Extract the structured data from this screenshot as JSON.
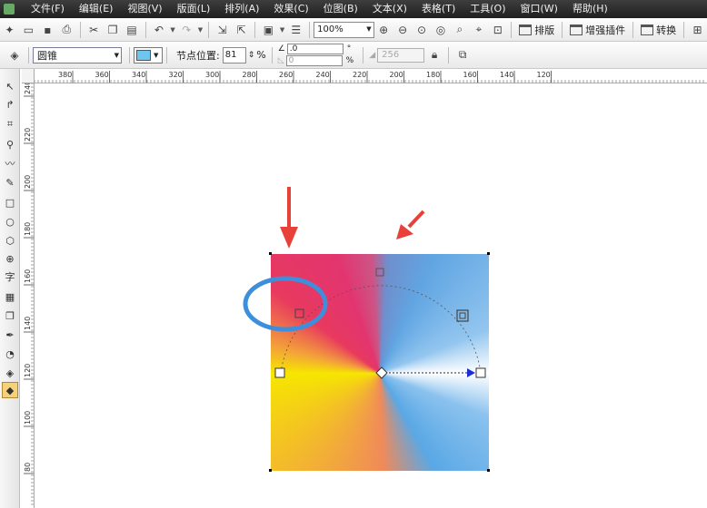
{
  "menu": [
    "文件(F)",
    "编辑(E)",
    "视图(V)",
    "版面(L)",
    "排列(A)",
    "效果(C)",
    "位图(B)",
    "文本(X)",
    "表格(T)",
    "工具(O)",
    "窗口(W)",
    "帮助(H)"
  ],
  "toolbar": {
    "zoom_value": "100%",
    "layout_label": "排版",
    "enhance_plugin_label": "增强插件",
    "convert_label": "转换"
  },
  "property_bar": {
    "fill_type": "圆锥",
    "node_position_label": "节点位置:",
    "node_position_value": "81",
    "node_position_unit": "%",
    "angle_value": ".0",
    "angle_unit": "°",
    "edge_value": "0",
    "edge_unit": "%",
    "steps_value": "256",
    "fill_color": "#6ec6f0"
  },
  "ruler_top_labels": [
    "380",
    "360",
    "340",
    "320",
    "300",
    "280",
    "260",
    "240",
    "220",
    "200",
    "180",
    "160",
    "140",
    "120"
  ],
  "ruler_left_labels": [
    "240",
    "220",
    "200",
    "180",
    "160",
    "140",
    "120",
    "100",
    "80"
  ],
  "toolbox_icons": [
    "pick-tool-icon",
    "shape-tool-icon",
    "crop-tool-icon",
    "zoom-tool-icon",
    "freehand-tool-icon",
    "smart-fill-tool-icon",
    "rectangle-tool-icon",
    "ellipse-tool-icon",
    "polygon-tool-icon",
    "basic-shapes-tool-icon",
    "text-tool-icon",
    "table-tool-icon",
    "interactive-blend-tool-icon",
    "eyedropper-tool-icon",
    "outline-tool-icon",
    "fill-tool-icon",
    "interactive-fill-tool-icon"
  ],
  "toolbox_glyphs": [
    "↖",
    "↱",
    "⌗",
    "⚲",
    "〰",
    "✎",
    "□",
    "○",
    "⬡",
    "⊕",
    "字",
    "▦",
    "❐",
    "✒",
    "◔",
    "◈",
    "◆"
  ],
  "colors": {
    "annotation_red": "#e8413a",
    "annotation_blue": "#3d8fdc",
    "gradient_start": "#f6e600",
    "gradient_end": "#6ec6f0"
  }
}
